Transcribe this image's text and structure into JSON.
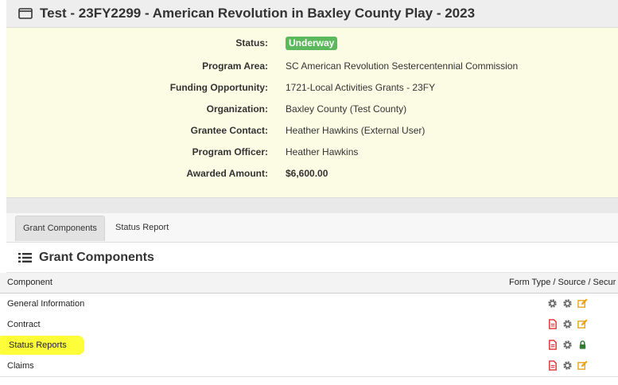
{
  "header": {
    "title": "Test - 23FY2299 - American Revolution in Baxley County Play - 2023",
    "icon": "window-icon"
  },
  "info": {
    "rows": [
      {
        "label": "Status:",
        "value": "Underway"
      },
      {
        "label": "Program Area:",
        "value": "SC American Revolution Sestercentennial Commission"
      },
      {
        "label": "Funding Opportunity:",
        "value": "1721-Local Activities Grants - 23FY"
      },
      {
        "label": "Organization:",
        "value": "Baxley County (Test County)"
      },
      {
        "label": "Grantee Contact:",
        "value": "Heather Hawkins (External User)"
      },
      {
        "label": "Program Officer:",
        "value": "Heather Hawkins"
      },
      {
        "label": "Awarded Amount:",
        "value": "$6,600.00"
      }
    ],
    "status_color": "#5cb85c"
  },
  "tabs": [
    {
      "label": "Grant Components",
      "active": true
    },
    {
      "label": "Status Report",
      "active": false
    }
  ],
  "section": {
    "title": "Grant Components",
    "icon": "list-icon"
  },
  "table": {
    "headers": [
      "Component",
      "Form Type / Source / Secur"
    ],
    "rows": [
      {
        "name": "General Information",
        "icons": [
          "gear-icon",
          "gear-icon",
          "edit-icon"
        ]
      },
      {
        "name": "Contract",
        "icons": [
          "pdf-icon",
          "gear-icon",
          "edit-icon"
        ]
      },
      {
        "name": "Status Reports",
        "icons": [
          "pdf-icon",
          "gear-icon",
          "lock-icon"
        ],
        "highlighted": true
      },
      {
        "name": "Claims",
        "icons": [
          "pdf-icon",
          "gear-icon",
          "edit-icon"
        ]
      }
    ]
  }
}
